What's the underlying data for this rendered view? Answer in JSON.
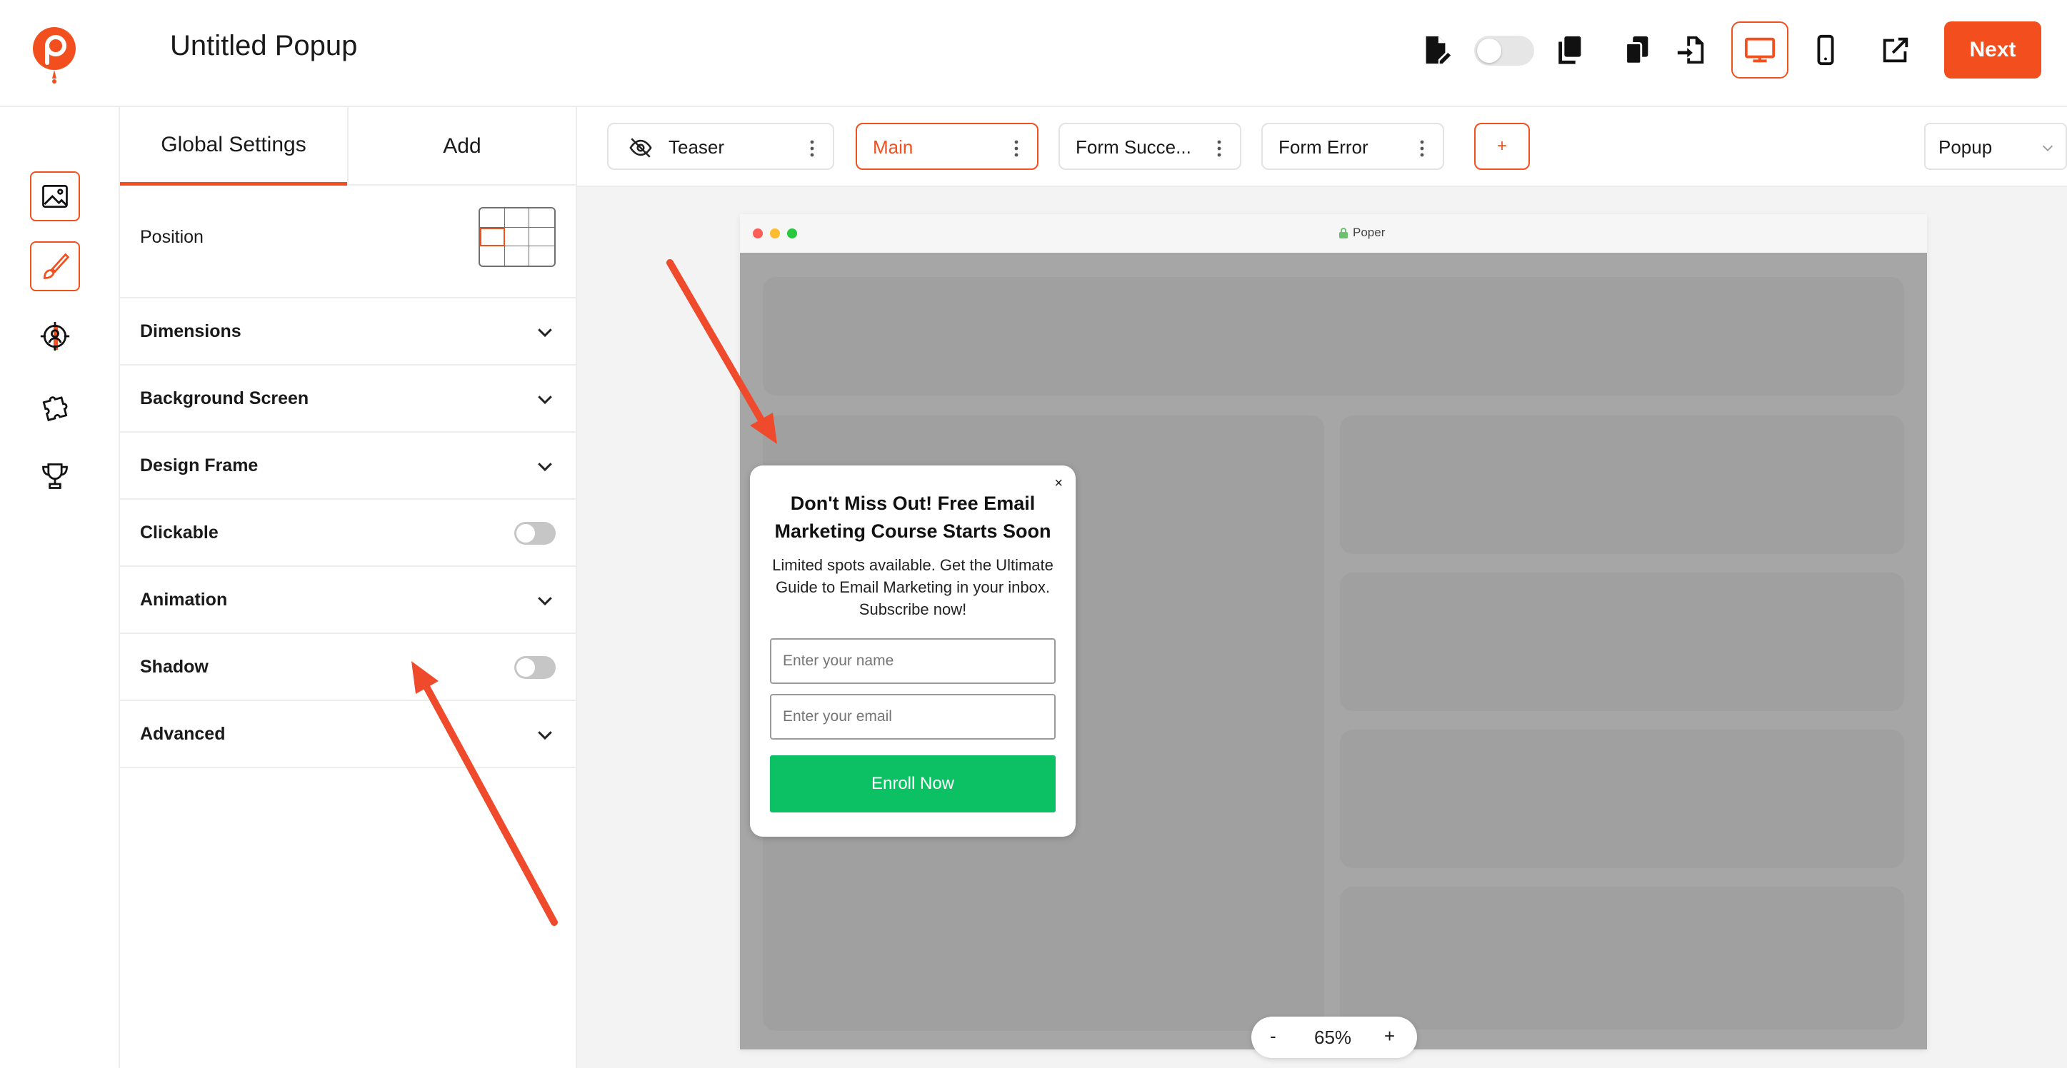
{
  "header": {
    "title": "Untitled Popup",
    "next_label": "Next"
  },
  "panel": {
    "tabs": [
      {
        "label": "Global Settings",
        "active": true
      },
      {
        "label": "Add",
        "active": false
      }
    ],
    "rows": {
      "position": "Position",
      "dimensions": "Dimensions",
      "background_screen": "Background Screen",
      "design_frame": "Design Frame",
      "clickable": "Clickable",
      "animation": "Animation",
      "shadow": "Shadow",
      "advanced": "Advanced"
    },
    "toggles": {
      "clickable": false,
      "shadow": false
    }
  },
  "steps": [
    {
      "label": "Teaser",
      "icon": "eye-off-icon",
      "active": false
    },
    {
      "label": "Main",
      "active": true
    },
    {
      "label": "Form Succe...",
      "active": false
    },
    {
      "label": "Form Error",
      "active": false
    }
  ],
  "step_add_label": "+",
  "type_select": {
    "value": "Popup"
  },
  "browser": {
    "url_label": "Poper"
  },
  "popup": {
    "close": "×",
    "title": "Don't Miss Out! Free Email Marketing Course Starts Soon",
    "description": "Limited spots available. Get the Ultimate Guide to Email Marketing in your inbox. Subscribe now!",
    "name_placeholder": "Enter your name",
    "email_placeholder": "Enter your email",
    "button_label": "Enroll Now"
  },
  "zoom": {
    "minus": "-",
    "value": "65%",
    "plus": "+"
  },
  "colors": {
    "accent": "#f24e1e",
    "enroll_button": "#0cc164",
    "placeholder_gray": "#a6a6a6"
  }
}
